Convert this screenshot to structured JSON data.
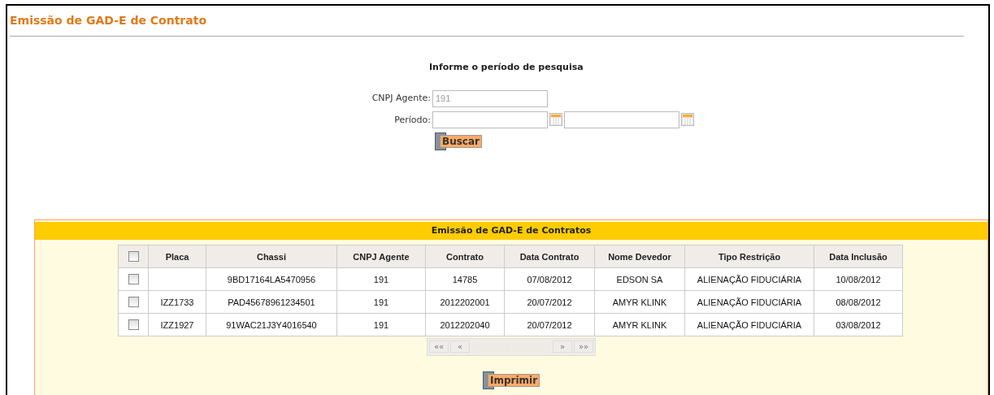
{
  "page_title": "Emissão de GAD-E de Contrato",
  "search_form": {
    "heading": "Informe o período de pesquisa",
    "fields": [
      {
        "label": "CNPJ Agente:",
        "kind": "text",
        "value": "191",
        "disabled": true
      },
      {
        "label": "Período:",
        "kind": "daterange"
      }
    ],
    "button": "Buscar"
  },
  "results": {
    "title": "Emissão de GAD-E de Contratos",
    "select_all_checked": false,
    "columns": [
      "Placa",
      "Chassi",
      "CNPJ Agente",
      "Contrato",
      "Data Contrato",
      "Nome Devedor",
      "Tipo Restrição",
      "Data Inclusão"
    ],
    "rows": [
      {
        "checked": false,
        "cells": [
          "",
          "9BD17164LA5470956",
          "191",
          "14785",
          "07/08/2012",
          "EDSON SA",
          "ALIENAÇÃO FIDUCIÁRIA",
          "10/08/2012"
        ]
      },
      {
        "checked": false,
        "cells": [
          "IZZ1733",
          "PAD45678961234501",
          "191",
          "2012202001",
          "20/07/2012",
          "AMYR KLINK",
          "ALIENAÇÃO FIDUCIÁRIA",
          "08/08/2012"
        ]
      },
      {
        "checked": false,
        "cells": [
          "IZZ1927",
          "91WAC21J3Y4016540",
          "191",
          "2012202040",
          "20/07/2012",
          "AMYR KLINK",
          "ALIENAÇÃO FIDUCIÁRIA",
          "03/08/2012"
        ]
      }
    ],
    "pager": [
      {
        "label": "««",
        "disabled": true
      },
      {
        "label": "«",
        "disabled": true
      },
      {
        "label": "»",
        "disabled": true
      },
      {
        "label": "»»",
        "disabled": true
      }
    ],
    "print_button": "Imprimir"
  }
}
